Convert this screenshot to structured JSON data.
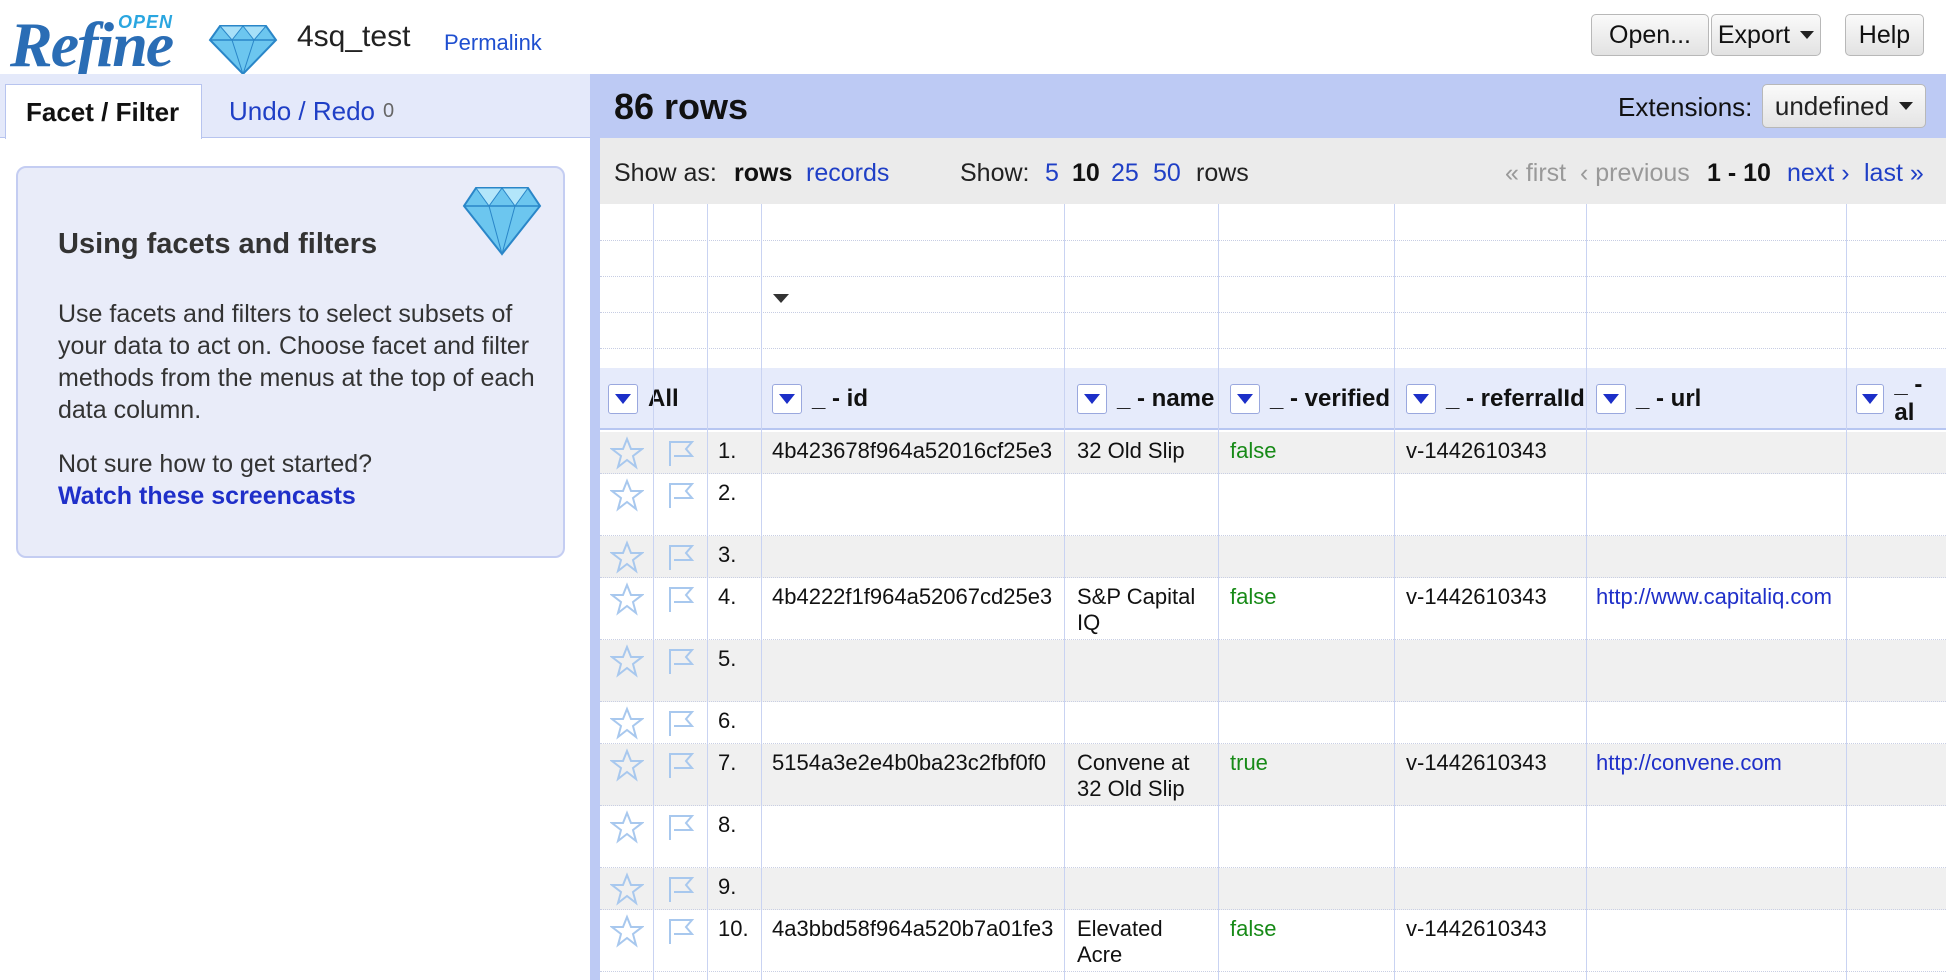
{
  "app": {
    "logo_main": "Refine",
    "logo_small": "OPEN",
    "project_name": "4sq_test",
    "permalink": "Permalink"
  },
  "header_buttons": {
    "open": "Open...",
    "export": "Export",
    "help": "Help"
  },
  "left_tabs": {
    "facet": "Facet / Filter",
    "undo": "Undo / Redo",
    "undo_count": "0"
  },
  "help": {
    "title": "Using facets and filters",
    "body": "Use facets and filters to select subsets of your data to act on. Choose facet and filter methods from the menus at the top of each data column.",
    "question": "Not sure how to get started?",
    "link": "Watch these screencasts"
  },
  "summary": {
    "row_count": "86 rows",
    "extensions_label": "Extensions:",
    "extensions_value": "undefined"
  },
  "view": {
    "show_as": "Show as:",
    "rows": "rows",
    "records": "records",
    "show": "Show:",
    "sizes": [
      "5",
      "10",
      "25",
      "50"
    ],
    "rows_suffix": "rows",
    "first": "« first",
    "previous": "‹ previous",
    "range": "1 - 10",
    "next": "next ›",
    "last": "last »"
  },
  "columns": {
    "all": "All",
    "id": "_ - id",
    "name": "_ - name",
    "verified": "_ - verified",
    "referral": "_ - referralId",
    "url": "_ - url",
    "partial": "_ - al"
  },
  "rows": [
    {
      "num": "1.",
      "id": "4b423678f964a52016cf25e3",
      "name": "32 Old Slip",
      "verified": "false",
      "referral": "v-1442610343",
      "url": ""
    },
    {
      "num": "2.",
      "id": "",
      "name": "",
      "verified": "",
      "referral": "",
      "url": ""
    },
    {
      "num": "3.",
      "id": "",
      "name": "",
      "verified": "",
      "referral": "",
      "url": ""
    },
    {
      "num": "4.",
      "id": "4b4222f1f964a52067cd25e3",
      "name": "S&P Capital IQ",
      "verified": "false",
      "referral": "v-1442610343",
      "url": "http://www.capitaliq.com"
    },
    {
      "num": "5.",
      "id": "",
      "name": "",
      "verified": "",
      "referral": "",
      "url": ""
    },
    {
      "num": "6.",
      "id": "",
      "name": "",
      "verified": "",
      "referral": "",
      "url": ""
    },
    {
      "num": "7.",
      "id": "5154a3e2e4b0ba23c2fbf0f0",
      "name": "Convene at 32 Old Slip",
      "verified": "true",
      "referral": "v-1442610343",
      "url": "http://convene.com"
    },
    {
      "num": "8.",
      "id": "",
      "name": "",
      "verified": "",
      "referral": "",
      "url": ""
    },
    {
      "num": "9.",
      "id": "",
      "name": "",
      "verified": "",
      "referral": "",
      "url": ""
    },
    {
      "num": "10.",
      "id": "4a3bbd58f964a520b7a01fe3",
      "name": "Elevated Acre",
      "verified": "false",
      "referral": "v-1442610343",
      "url": ""
    }
  ],
  "colors": {
    "accent": "#1f3fc6",
    "summary_bg": "#bdcaf4",
    "true_false": "#178a17"
  }
}
